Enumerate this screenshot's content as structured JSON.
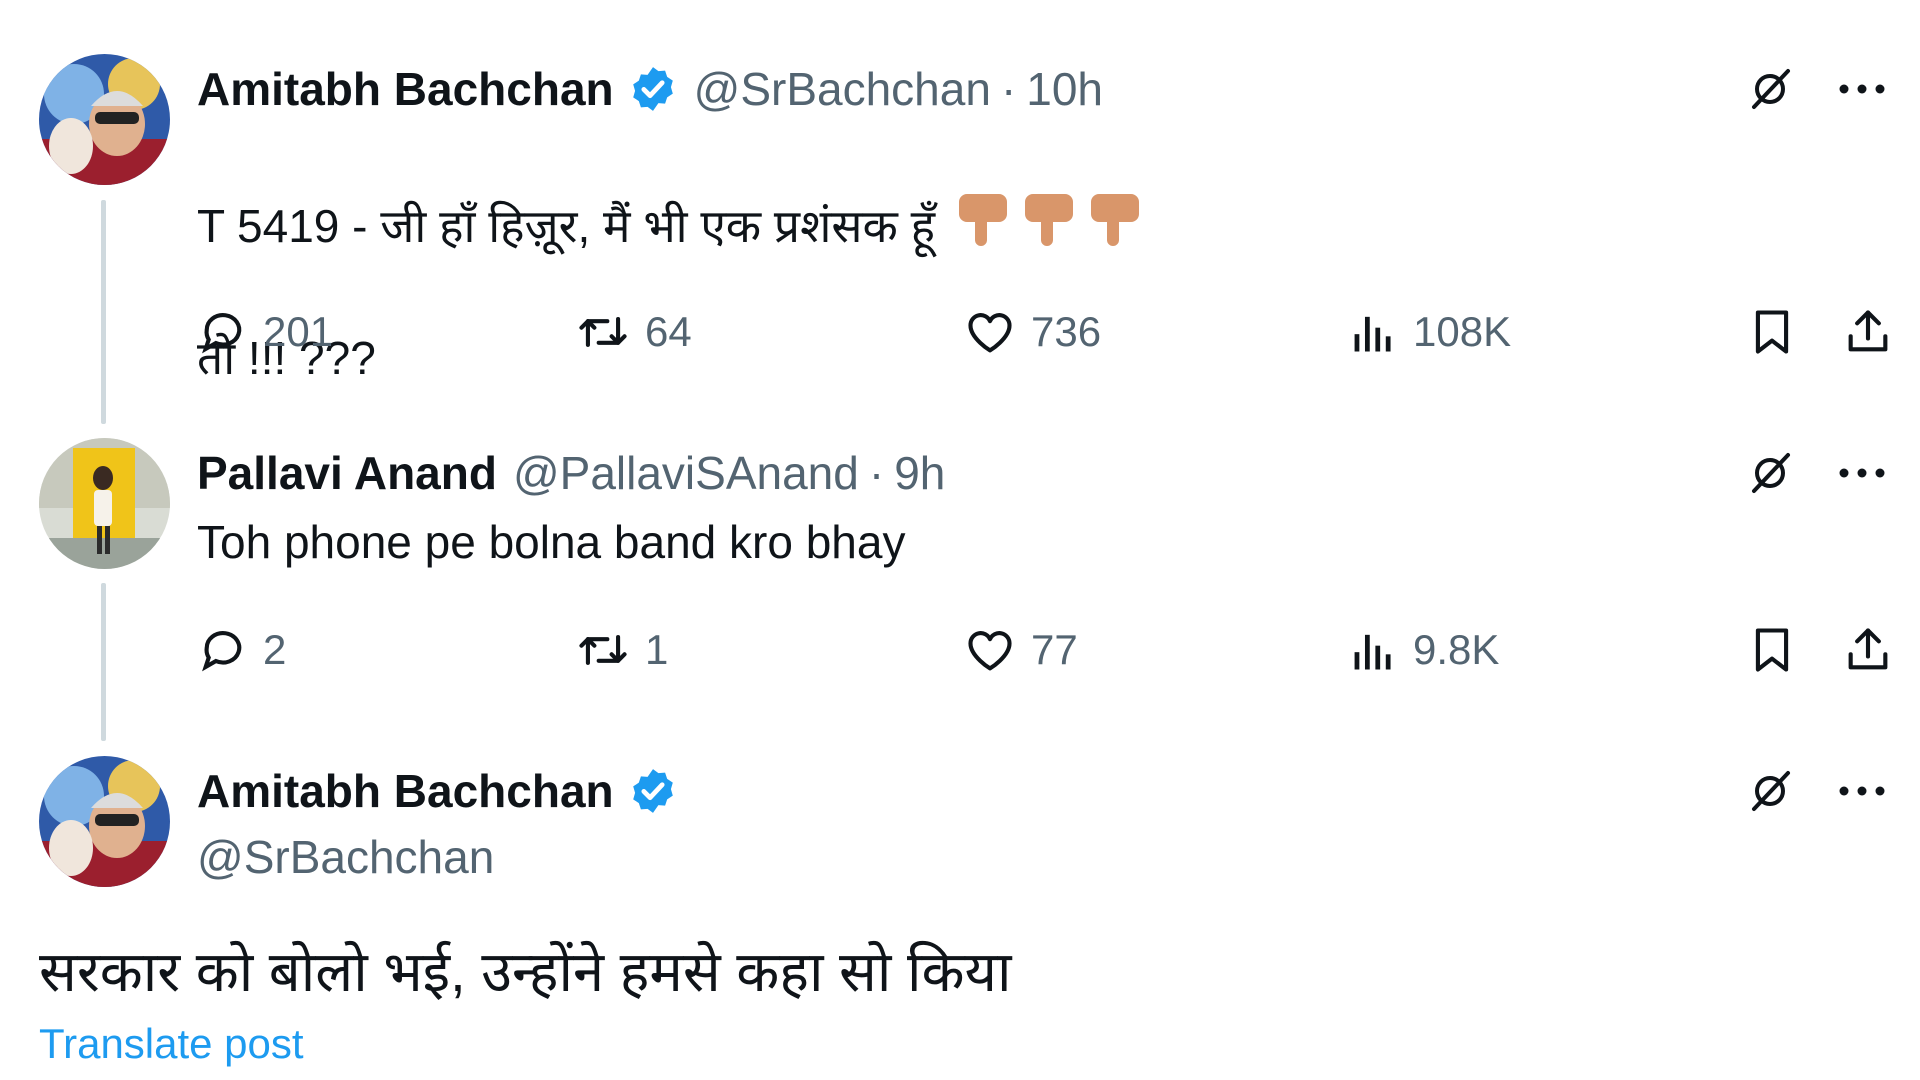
{
  "tweets": [
    {
      "author_name": "Amitabh Bachchan",
      "verified": true,
      "handle": "@SrBachchan",
      "separator": "·",
      "time": "10h",
      "text_line1": "T 5419 - जी हाँ हिज़ूर, मैं भी एक प्रशंसक हूँ",
      "text_line2": "तो !!! ???",
      "emoji": "point-down-hand",
      "stats": {
        "replies": "201",
        "reposts": "64",
        "likes": "736",
        "views": "108K"
      }
    },
    {
      "author_name": "Pallavi Anand",
      "verified": false,
      "handle": "@PallaviSAnand",
      "separator": "·",
      "time": "9h",
      "text": "Toh phone pe bolna band kro bhay",
      "stats": {
        "replies": "2",
        "reposts": "1",
        "likes": "77",
        "views": "9.8K"
      }
    },
    {
      "author_name": "Amitabh Bachchan",
      "verified": true,
      "handle": "@SrBachchan",
      "text": "सरकार को बोलो भई, उन्होंने हमसे कहा सो किया",
      "translate_label": "Translate post"
    }
  ],
  "icons": {
    "reply": "reply-icon",
    "repost": "repost-icon",
    "like": "heart-icon",
    "views": "views-icon",
    "bookmark": "bookmark-icon",
    "share": "share-icon",
    "grok": "grok-icon",
    "more": "more-icon",
    "verified": "verified-badge-icon"
  },
  "colors": {
    "text": "#0f1419",
    "muted": "#536471",
    "link": "#1d9bf0",
    "verified": "#1d9bf0",
    "thread_line": "#cfd9de"
  }
}
